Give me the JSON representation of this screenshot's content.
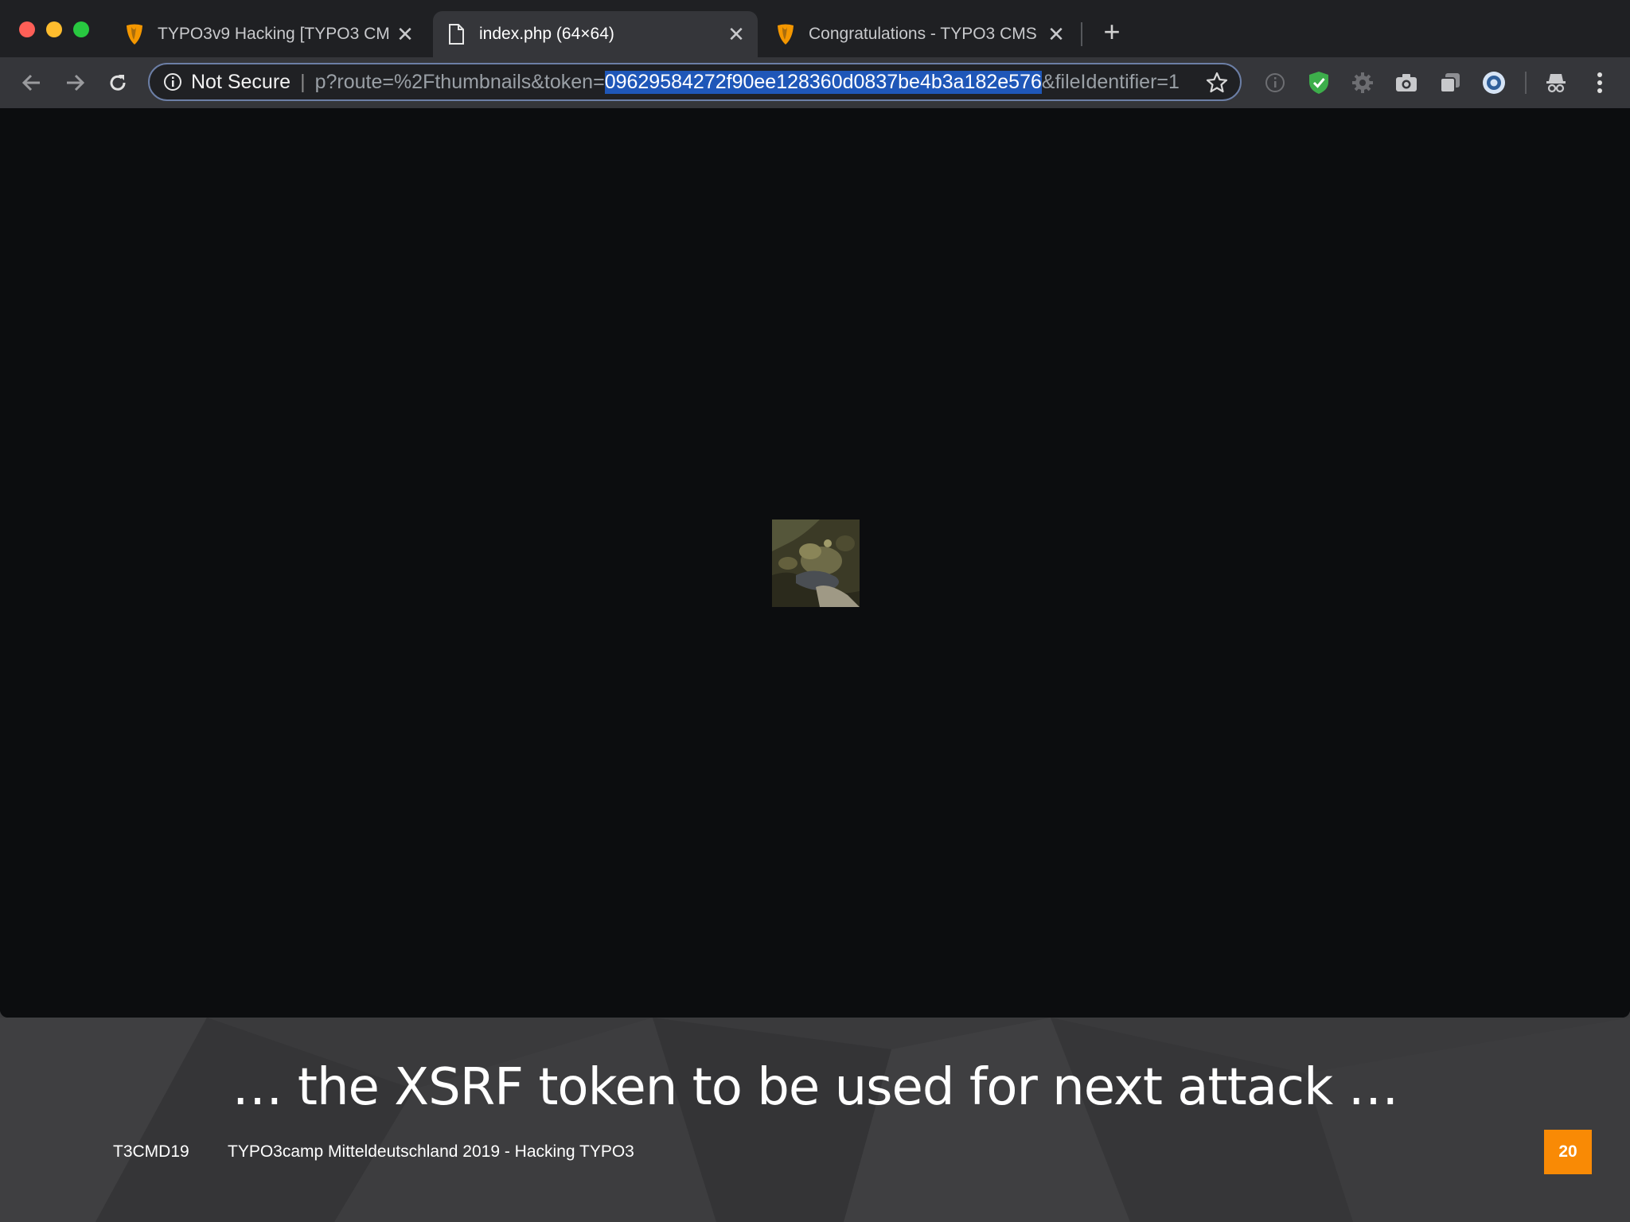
{
  "browser": {
    "tabs": [
      {
        "title": "TYPO3v9 Hacking [TYPO3 CM",
        "active": false,
        "icon": "typo3-icon"
      },
      {
        "title": "index.php (64×64)",
        "active": true,
        "icon": "document-icon"
      },
      {
        "title": "Congratulations - TYPO3 CMS",
        "active": false,
        "icon": "typo3-icon"
      }
    ],
    "address_bar": {
      "security_label": "Not Secure",
      "url_before_selection": "p?route=%2Fthumbnails&token=",
      "url_selected": "09629584272f90ee128360d0837be4b3a182e576",
      "url_after_selection": "&fileIdentifier=1"
    },
    "extensions": [
      "info-icon",
      "shield-check-icon",
      "gear-icon",
      "camera-icon",
      "copy-icon",
      "circle-icon",
      "incognito-icon",
      "menu-dots-icon"
    ]
  },
  "content": {
    "image_description_icon": "thumbnail-image"
  },
  "slide": {
    "caption": "… the XSRF token to be used for next attack …",
    "footer_tag": "T3CMD19",
    "footer_title": "TYPO3camp Mitteldeutschland 2019 - Hacking TYPO3",
    "page_number": "20"
  },
  "colors": {
    "accent_orange": "#f98a05",
    "selection_blue": "#1f57b8",
    "typo3_orange": "#f49700"
  }
}
